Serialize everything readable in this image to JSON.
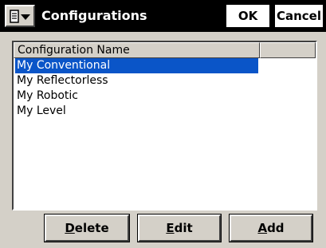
{
  "window": {
    "title": "Configurations",
    "ok_label": "OK",
    "cancel_label": "Cancel",
    "menu_icon": "menu-dropdown-icon"
  },
  "list": {
    "columns": [
      "Configuration Name",
      ""
    ],
    "rows": [
      {
        "name": "My Conventional",
        "selected": true
      },
      {
        "name": "My Reflectorless",
        "selected": false
      },
      {
        "name": "My Robotic",
        "selected": false
      },
      {
        "name": "My Level",
        "selected": false
      }
    ]
  },
  "buttons": {
    "delete": {
      "accel": "D",
      "rest": "elete"
    },
    "edit": {
      "accel": "E",
      "rest": "dit"
    },
    "add": {
      "accel": "A",
      "rest": "dd"
    }
  },
  "colors": {
    "titlebar": "#000000",
    "selection": "#0a55c8",
    "dialog_face": "#d4d0c8"
  }
}
